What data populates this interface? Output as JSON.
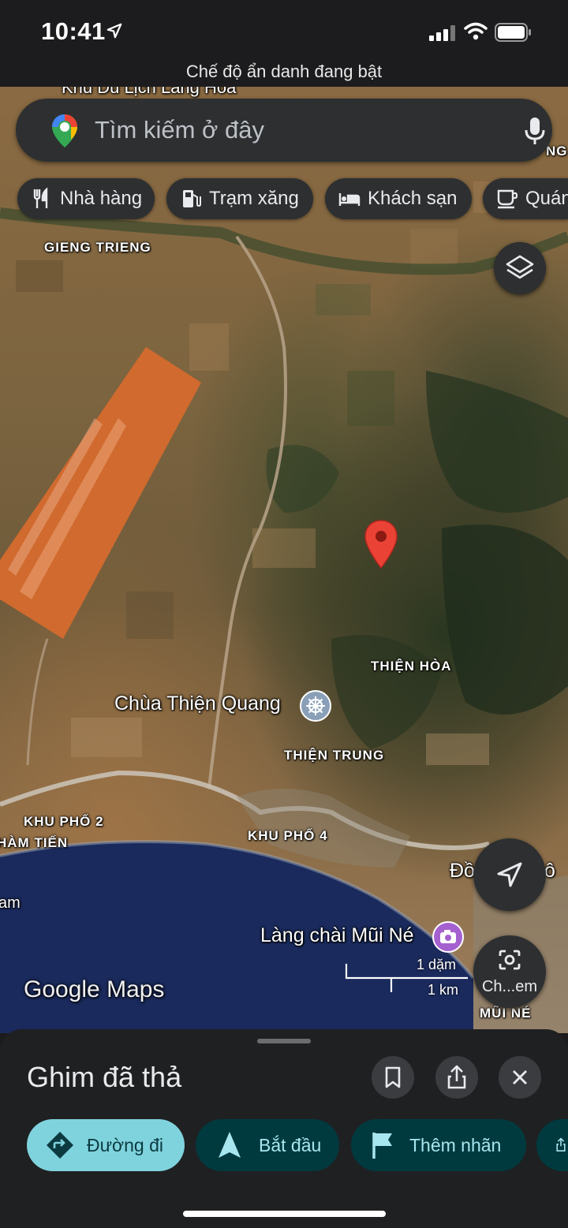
{
  "status_bar": {
    "time": "10:41"
  },
  "incognito_banner": "Chế độ ẩn danh đang bật",
  "search": {
    "placeholder": "Tìm kiếm ở đây"
  },
  "chips": [
    {
      "label": "Nhà hàng",
      "icon": "fork-knife-icon"
    },
    {
      "label": "Trạm xăng",
      "icon": "gas-station-icon"
    },
    {
      "label": "Khách sạn",
      "icon": "bed-icon"
    },
    {
      "label": "Quán",
      "icon": "coffee-cup-icon"
    }
  ],
  "map": {
    "partial_top_label": "Khu Du Lịch Làng Hòa",
    "right_top_label": "NG",
    "places": {
      "gieng_trieng": "GIENG TRIENG",
      "thien_hoa": "THIỆN HÒA",
      "chua_thien_quang": "Chùa Thiện Quang",
      "thien_trung": "THIỆN TRUNG",
      "khu_pho_2": "KHU PHỐ 2",
      "ham_tien": "HÀM TIẾN",
      "khu_pho_4": "KHU PHỐ 4",
      "lang_chai_mui_ne": "Làng chài Mũi Né",
      "doi": "Đồ",
      "doi_right": "ô",
      "mui_ne": "MŨI NÉ",
      "sea_partial": "am"
    },
    "scale": {
      "miles": "1 dặm",
      "km": "1 km"
    },
    "watermark": "Google Maps",
    "camera_button_label": "Ch...em"
  },
  "bottom_sheet": {
    "title": "Ghim đã thả",
    "actions": [
      {
        "label": "Đường đi",
        "icon": "directions-icon"
      },
      {
        "label": "Bắt đầu",
        "icon": "navigation-arrow-icon"
      },
      {
        "label": "Thêm nhãn",
        "icon": "flag-icon"
      }
    ]
  },
  "colors": {
    "accent": "#7fd3dd",
    "pin": "#ea4335",
    "dark_surface": "#2d2f31",
    "action_bg": "#003a3f"
  }
}
